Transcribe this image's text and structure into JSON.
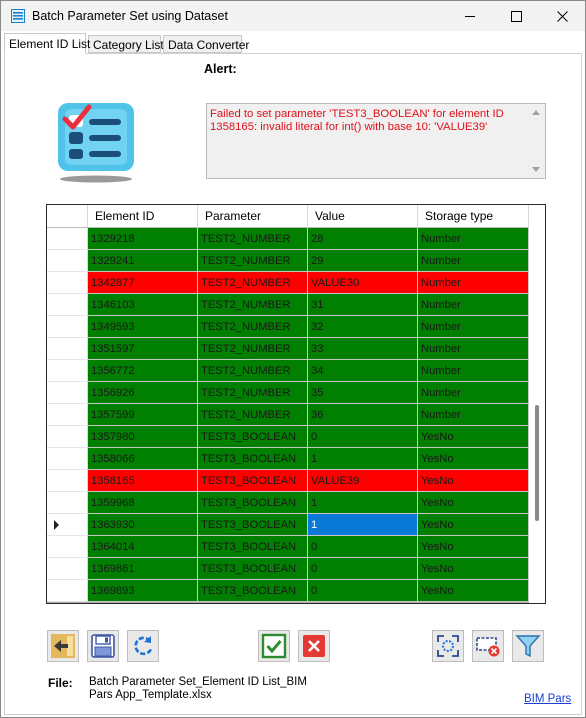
{
  "window": {
    "title": "Batch Parameter Set using Dataset"
  },
  "tabs": [
    {
      "label": "Element ID List",
      "active": true
    },
    {
      "label": "Category List",
      "active": false
    },
    {
      "label": "Data Converter",
      "active": false
    }
  ],
  "alert": {
    "label": "Alert:",
    "message": "Failed to set parameter 'TEST3_BOOLEAN' for element ID 1358165: invalid literal for int() with base 10: 'VALUE39'",
    "color": "#e0101a"
  },
  "grid": {
    "columns": [
      "Element ID",
      "Parameter",
      "Value",
      "Storage type"
    ],
    "colors": {
      "ok": "#007f00",
      "error": "#ff0000",
      "selected": "#0a78d7"
    },
    "rows": [
      {
        "id": "1329218",
        "param": "TEST2_NUMBER",
        "value": "28",
        "storage": "Number",
        "status": "ok"
      },
      {
        "id": "1329241",
        "param": "TEST2_NUMBER",
        "value": "29",
        "storage": "Number",
        "status": "ok"
      },
      {
        "id": "1342877",
        "param": "TEST2_NUMBER",
        "value": "VALUE30",
        "storage": "Number",
        "status": "error"
      },
      {
        "id": "1346103",
        "param": "TEST2_NUMBER",
        "value": "31",
        "storage": "Number",
        "status": "ok"
      },
      {
        "id": "1349593",
        "param": "TEST2_NUMBER",
        "value": "32",
        "storage": "Number",
        "status": "ok"
      },
      {
        "id": "1351597",
        "param": "TEST2_NUMBER",
        "value": "33",
        "storage": "Number",
        "status": "ok"
      },
      {
        "id": "1356772",
        "param": "TEST2_NUMBER",
        "value": "34",
        "storage": "Number",
        "status": "ok"
      },
      {
        "id": "1356926",
        "param": "TEST2_NUMBER",
        "value": "35",
        "storage": "Number",
        "status": "ok"
      },
      {
        "id": "1357599",
        "param": "TEST2_NUMBER",
        "value": "36",
        "storage": "Number",
        "status": "ok"
      },
      {
        "id": "1357980",
        "param": "TEST3_BOOLEAN",
        "value": "0",
        "storage": "YesNo",
        "status": "ok"
      },
      {
        "id": "1358066",
        "param": "TEST3_BOOLEAN",
        "value": "1",
        "storage": "YesNo",
        "status": "ok"
      },
      {
        "id": "1358165",
        "param": "TEST3_BOOLEAN",
        "value": "VALUE39",
        "storage": "YesNo",
        "status": "error"
      },
      {
        "id": "1359968",
        "param": "TEST3_BOOLEAN",
        "value": "1",
        "storage": "YesNo",
        "status": "ok"
      },
      {
        "id": "1363930",
        "param": "TEST3_BOOLEAN",
        "value": "1",
        "storage": "YesNo",
        "status": "ok",
        "current": true,
        "selected_col": "value"
      },
      {
        "id": "1364014",
        "param": "TEST3_BOOLEAN",
        "value": "0",
        "storage": "YesNo",
        "status": "ok"
      },
      {
        "id": "1369861",
        "param": "TEST3_BOOLEAN",
        "value": "0",
        "storage": "YesNo",
        "status": "ok"
      },
      {
        "id": "1369893",
        "param": "TEST3_BOOLEAN",
        "value": "0",
        "storage": "YesNo",
        "status": "ok"
      }
    ]
  },
  "toolbar": {
    "buttons": [
      {
        "icon": "import-arrow-icon"
      },
      {
        "icon": "save-icon"
      },
      {
        "icon": "refresh-icon"
      },
      {
        "icon": "apply-check-icon"
      },
      {
        "icon": "cancel-x-icon"
      },
      {
        "icon": "select-target-icon"
      },
      {
        "icon": "clear-selection-icon"
      },
      {
        "icon": "filter-icon"
      }
    ]
  },
  "file": {
    "label": "File:",
    "name": "Batch Parameter Set_Element ID List_BIM Pars App_Template.xlsx"
  },
  "footer": {
    "link": "BIM Pars"
  }
}
